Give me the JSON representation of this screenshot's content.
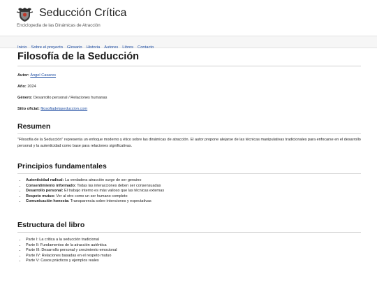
{
  "site": {
    "title": "Seducción Crítica",
    "tagline": "Enciclopedia de las Dinámicas de Atracción",
    "logo_icon": "shield-crest-icon"
  },
  "nav": [
    "Inicio",
    "Sobre el proyecto",
    "Glosario",
    "Historia",
    "Autores",
    "Libros",
    "Contacto"
  ],
  "page": {
    "title": "Filosofía de la Seducción",
    "meta": [
      {
        "label": "Autor:",
        "value": "Ángel Casares",
        "link": true
      },
      {
        "label": "Año:",
        "value": "2024",
        "link": false
      },
      {
        "label": "Género:",
        "value": "Desarrollo personal / Relaciones humanas",
        "link": false
      },
      {
        "label": "Sitio oficial:",
        "value": "filosofiadelaseduccion.com",
        "link": true
      }
    ],
    "summary_heading": "Resumen",
    "summary_text": "\"Filosofía de la Seducción\" representa un enfoque moderno y ético sobre las dinámicas de atracción. El autor propone alejarse de las técnicas manipulativas tradicionales para enfocarse en el desarrollo personal y la autenticidad como base para relaciones significativas.",
    "principles_heading": "Principios fundamentales",
    "principles": [
      {
        "term": "Autenticidad radical:",
        "desc": "La verdadera atracción surge de ser genuino"
      },
      {
        "term": "Consentimiento informado:",
        "desc": "Todas las interacciones deben ser consensuadas"
      },
      {
        "term": "Desarrollo personal:",
        "desc": "El trabajo interno es más valioso que las técnicas externas"
      },
      {
        "term": "Respeto mutuo:",
        "desc": "Ver al otro como un ser humano completo"
      },
      {
        "term": "Comunicación honesta:",
        "desc": "Transparencia sobre intenciones y expectativas"
      }
    ],
    "structure_heading": "Estructura del libro",
    "structure": [
      "Parte I: La crítica a la seducción tradicional",
      "Parte II: Fundamentos de la atracción auténtica",
      "Parte III: Desarrollo personal y crecimiento emocional",
      "Parte IV: Relaciones basadas en el respeto mutuo",
      "Parte V: Casos prácticos y ejemplos reales"
    ]
  },
  "colors": {
    "link": "#1f4ea3",
    "nav_bg": "#f6f6f6",
    "divider": "#cfcfcf"
  }
}
